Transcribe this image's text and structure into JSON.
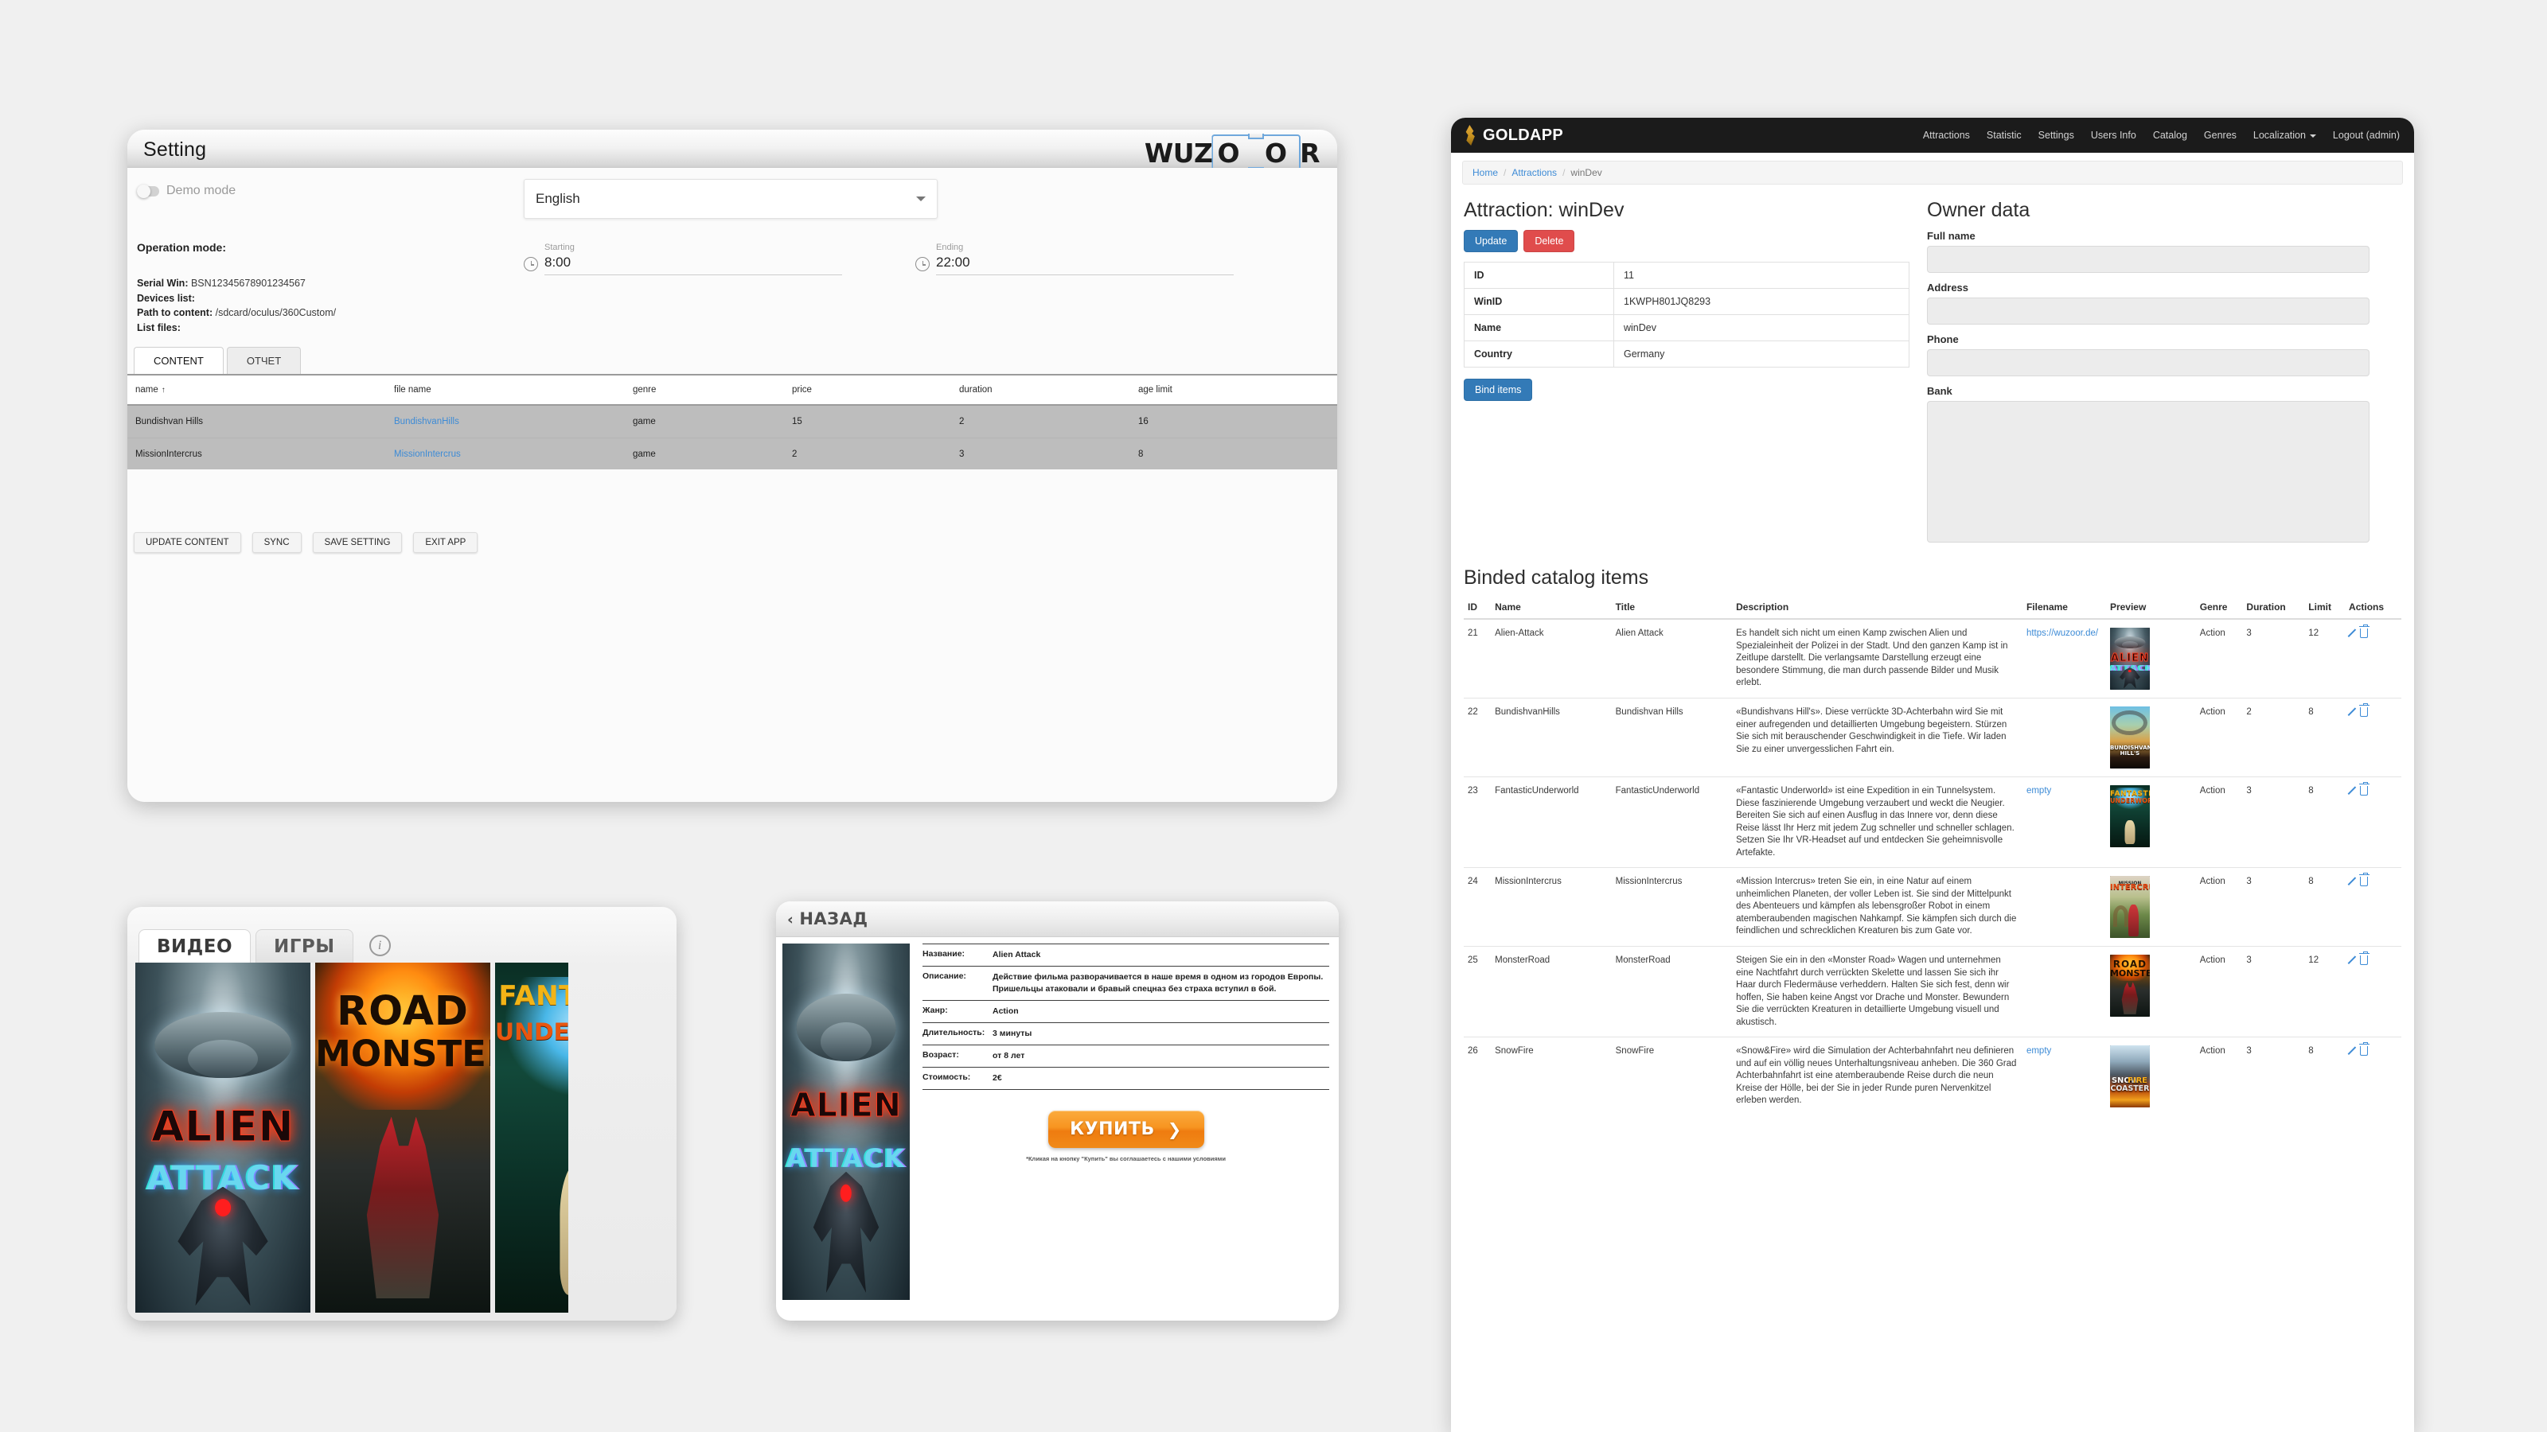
{
  "settings_window": {
    "title": "Setting",
    "logo": {
      "prefix": "WUZ",
      "vr_letters": "O O",
      "suffix": "R"
    },
    "demo_mode_label": "Demo mode",
    "operation_mode_label": "Operation mode:",
    "fields": [
      {
        "key": "Serial Win:",
        "value": "BSN12345678901234567"
      },
      {
        "key": "Devices list:",
        "value": ""
      },
      {
        "key": "Path to content:",
        "value": "/sdcard/oculus/360Custom/"
      },
      {
        "key": "List files:",
        "value": ""
      }
    ],
    "language": {
      "value": "English"
    },
    "starting": {
      "label": "Starting",
      "value": "8:00"
    },
    "ending": {
      "label": "Ending",
      "value": "22:00"
    },
    "tabs": [
      {
        "label": "CONTENT",
        "active": true
      },
      {
        "label": "ОТЧЕТ",
        "active": false
      }
    ],
    "content_table": {
      "columns": [
        "name",
        "file name",
        "genre",
        "price",
        "duration",
        "age limit"
      ],
      "sort_indicator": "↑",
      "rows": [
        {
          "name": "Bundishvan Hills",
          "file_name": "BundishvanHills",
          "genre": "game",
          "price": "15",
          "duration": "2",
          "age_limit": "16"
        },
        {
          "name": "MissionIntercrus",
          "file_name": "MissionIntercrus",
          "genre": "game",
          "price": "2",
          "duration": "3",
          "age_limit": "8"
        }
      ]
    },
    "buttons": [
      "UPDATE CONTENT",
      "SYNC",
      "SAVE SETTING",
      "EXIT APP"
    ]
  },
  "goldapp": {
    "brand": "GOLDAPP",
    "nav": [
      "Attractions",
      "Statistic",
      "Settings",
      "Users Info",
      "Catalog",
      "Genres",
      "Localization",
      "Logout (admin)"
    ],
    "localization_caret": "▾",
    "breadcrumb": [
      "Home",
      "Attractions",
      "winDev"
    ],
    "attraction": {
      "heading": "Attraction: winDev",
      "update_label": "Update",
      "delete_label": "Delete",
      "bind_label": "Bind items",
      "rows": [
        {
          "label": "ID",
          "value": "11"
        },
        {
          "label": "WinID",
          "value": "1KWPH801JQ8293"
        },
        {
          "label": "Name",
          "value": "winDev"
        },
        {
          "label": "Country",
          "value": "Germany"
        }
      ]
    },
    "owner": {
      "heading": "Owner data",
      "fields": [
        {
          "label": "Full name",
          "value": ""
        },
        {
          "label": "Address",
          "value": ""
        },
        {
          "label": "Phone",
          "value": ""
        },
        {
          "label": "Bank",
          "value": ""
        }
      ]
    },
    "catalog": {
      "heading": "Binded catalog items",
      "columns": [
        "ID",
        "Name",
        "Title",
        "Description",
        "Filename",
        "Preview",
        "Genre",
        "Duration",
        "Limit",
        "Actions"
      ],
      "rows": [
        {
          "id": "21",
          "name": "Alien-Attack",
          "title": "Alien Attack",
          "description": "Es handelt sich nicht um einen Kamp zwischen Alien und Spezialeinheit der Polizei in der Stadt. Und den ganzen Kamp ist in Zeitlupe darstellt. Die verlangsamte Darstellung erzeugt eine besondere Stimmung, die man durch passende Bilder und Musik erlebt.",
          "filename": "https://wuzoor.de/",
          "filename_is_link": true,
          "genre": "Action",
          "duration": "3",
          "limit": "12",
          "art": "alien"
        },
        {
          "id": "22",
          "name": "BundishvanHills",
          "title": "Bundishvan Hills",
          "description": "«Bundishvans Hill's». Diese verrückte 3D-Achterbahn wird Sie mit einer aufregenden und detaillierten Umgebung begeistern. Stürzen Sie sich mit berauschender Geschwindigkeit in die Tiefe. Wir laden Sie zu einer unvergesslichen Fahrt ein.",
          "filename": "",
          "filename_is_link": false,
          "genre": "Action",
          "duration": "2",
          "limit": "8",
          "art": "bundish"
        },
        {
          "id": "23",
          "name": "FantasticUnderworld",
          "title": "FantasticUnderworld",
          "description": "«Fantastic Underworld» ist eine Expedition in ein Tunnelsystem. Diese faszinierende Umgebung verzaubert und weckt die Neugier. Bereiten Sie sich auf einen Ausflug in das Innere vor, denn diese Reise lässt Ihr Herz mit jedem Zug schneller und schneller schlagen. Setzen Sie Ihr VR-Headset auf und entdecken Sie geheimnisvolle Artefakte.",
          "filename": "empty",
          "filename_is_link": true,
          "genre": "Action",
          "duration": "3",
          "limit": "8",
          "art": "fantastic"
        },
        {
          "id": "24",
          "name": "MissionIntercrus",
          "title": "MissionIntercrus",
          "description": "«Mission Intercrus» treten Sie ein, in eine Natur auf einem unheimlichen Planeten, der voller Leben ist. Sie sind der Mittelpunkt des Abenteuers und kämpfen als lebensgroßer Robot in einem atemberaubenden magischen Nahkampf. Sie kämpfen sich durch die feindlichen und schrecklichen Kreaturen bis zum Gate vor.",
          "filename": "",
          "filename_is_link": false,
          "genre": "Action",
          "duration": "3",
          "limit": "8",
          "art": "mission"
        },
        {
          "id": "25",
          "name": "MonsterRoad",
          "title": "MonsterRoad",
          "description": "Steigen Sie ein in den «Monster Road» Wagen und unternehmen eine Nachtfahrt durch verrückten Skelette und lassen Sie sich ihr Haar durch Fledermäuse verheddern. Halten Sie sich fest, denn wir hoffen, Sie haben keine Angst vor Drache und Monster. Bewundern Sie die verrückten Kreaturen in detaillierte Umgebung visuell und akustisch.",
          "filename": "",
          "filename_is_link": false,
          "genre": "Action",
          "duration": "3",
          "limit": "12",
          "art": "road"
        },
        {
          "id": "26",
          "name": "SnowFire",
          "title": "SnowFire",
          "description": "«Snow&Fire» wird die Simulation der Achterbahnfahrt neu definieren und auf ein völlig neues Unterhaltungsniveau anheben. Die 360 Grad Achterbahnfahrt ist eine atemberaubende Reise durch die neun Kreise der Hölle, bei der Sie in jeder Runde puren Nervenkitzel erleben werden.",
          "filename": "empty",
          "filename_is_link": true,
          "genre": "Action",
          "duration": "3",
          "limit": "8",
          "art": "snow"
        }
      ]
    }
  },
  "kiosk_list": {
    "tabs": [
      {
        "label": "ВИДЕО",
        "active": true
      },
      {
        "label": "ИГРЫ",
        "active": false
      }
    ],
    "info_icon_label": "i",
    "tiles": [
      {
        "art": "alien",
        "title_top": "ALIEN",
        "title_bottom": "ATTACK"
      },
      {
        "art": "road",
        "title_top": "ROAD",
        "title_bottom": "MONSTER"
      },
      {
        "art": "fantastic",
        "title_top": "FANTASTIC",
        "title_bottom": "UNDERWORLD"
      }
    ]
  },
  "kiosk_detail": {
    "back_label": "НАЗАД",
    "back_chevron": "‹",
    "poster": {
      "art": "alien",
      "title_top": "ALIEN",
      "title_bottom": "ATTACK"
    },
    "rows": [
      {
        "key": "Название:",
        "value": "Alien Attack"
      },
      {
        "key": "Описание:",
        "value": "Действие фильма разворачивается в наше время в одном из городов Европы. Пришельцы атаковали и бравый спецназ без страха вступил в бой."
      },
      {
        "key": "Жанр:",
        "value": "Action"
      },
      {
        "key": "Длительность:",
        "value": "3 минуты"
      },
      {
        "key": "Возраст:",
        "value": "от 8 лет"
      },
      {
        "key": "Стоимость:",
        "value": "2€"
      }
    ],
    "buy_label": "КУПИТЬ",
    "buy_arrow": "❯",
    "buy_note": "*Кликая на кнопку \"Купить\" вы соглашаетесь с нашими условиями"
  },
  "colors": {
    "page_background": "#f0f0f0",
    "nav_dark": "#1b1b1b",
    "brand_gold": "#c8921f",
    "link_blue": "#3d8bd6",
    "primary_blue": "#337ab7",
    "danger_red": "#e04c4c",
    "buy_orange": "#f79420",
    "table_row_grey": "#bdbdbd"
  }
}
